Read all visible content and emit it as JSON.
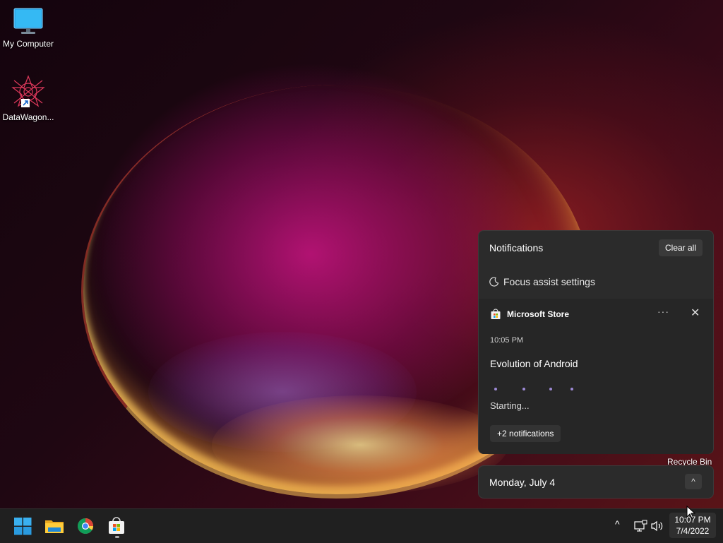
{
  "desktop": {
    "icons": [
      {
        "label": "My Computer"
      },
      {
        "label": "DataWagon..."
      }
    ],
    "recycle_bin": "Recycle Bin"
  },
  "notifications": {
    "header": "Notifications",
    "clear_all": "Clear all",
    "focus_assist": "Focus assist settings",
    "card": {
      "app": "Microsoft Store",
      "more": "···",
      "close": "✕",
      "time": "10:05 PM",
      "title": "Evolution of Android",
      "status": "Starting...",
      "more_notifications": "+2 notifications"
    }
  },
  "calendar": {
    "date": "Monday, July 4",
    "toggle": "^"
  },
  "taskbar": {
    "apps": [
      "start-icon",
      "file-explorer-icon",
      "chrome-icon",
      "microsoft-store-icon"
    ],
    "tray_chevron": "^",
    "clock_time": "10:07 PM",
    "clock_date": "7/4/2022"
  }
}
